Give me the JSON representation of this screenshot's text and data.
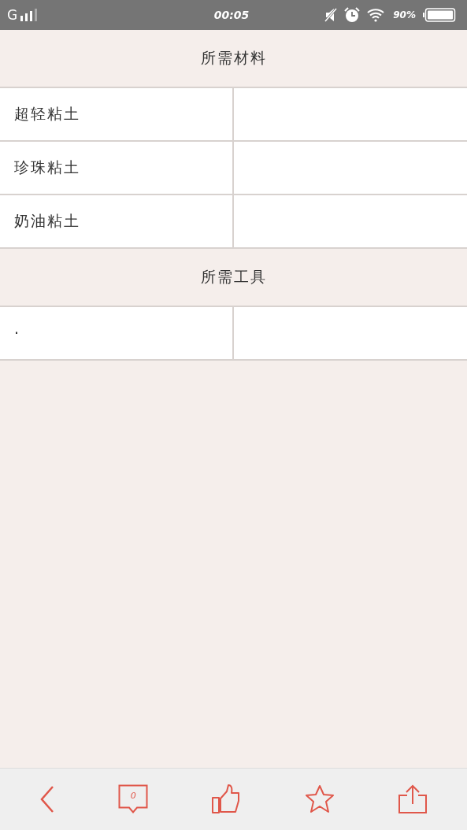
{
  "status_bar": {
    "carrier": "G",
    "time": "00:05",
    "battery": "90%"
  },
  "sections": [
    {
      "title": "所需材料",
      "rows": [
        {
          "name": "超轻粘土"
        },
        {
          "name": "珍珠粘土"
        },
        {
          "name": "奶油粘土"
        }
      ]
    },
    {
      "title": "所需工具",
      "rows": [
        {
          "name": "·"
        }
      ]
    }
  ],
  "bottom_bar": {
    "comment_count": "0"
  }
}
